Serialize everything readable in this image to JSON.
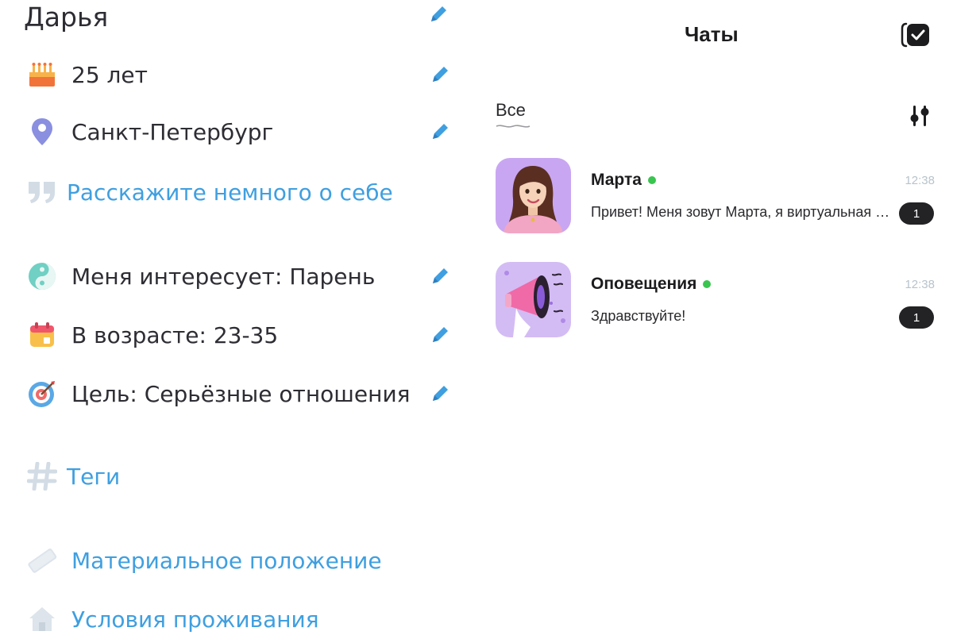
{
  "profile": {
    "name": "Дарья",
    "age": "25 лет",
    "city": "Санкт-Петербург",
    "about_prompt": "Расскажите немного о себе",
    "interest": "Меня интересует: Парень",
    "age_range": "В возрасте: 23-35",
    "goal": "Цель: Серьёзные отношения",
    "tags": "Теги",
    "finance": "Материальное положение",
    "living": "Условия проживания",
    "icons": {
      "age": "birthday-cake-icon",
      "city": "location-pin-icon",
      "about": "quote-icon",
      "interest": "yin-yang-icon",
      "age_range": "calendar-icon",
      "goal": "target-icon",
      "tags": "hashtag-icon",
      "finance": "money-icon",
      "living": "house-icon",
      "edit": "pencil-icon"
    },
    "link_color": "#3f9fe0",
    "muted_icon_color": "#cfd8e0"
  },
  "chats": {
    "title": "Чаты",
    "filter_tab": "Все",
    "icons": {
      "header": "check-square-icon",
      "filter": "sliders-icon"
    },
    "items": [
      {
        "name": "Марта",
        "online": true,
        "time": "12:38",
        "message": "Привет! Меня зовут Марта, я виртуальная помощница",
        "unread": "1",
        "avatar": "woman-portrait-avatar"
      },
      {
        "name": "Оповещения",
        "online": true,
        "time": "12:38",
        "message": "Здравствуйте!",
        "unread": "1",
        "avatar": "megaphone-avatar"
      }
    ],
    "online_color": "#39c54f",
    "badge_color": "#232326"
  }
}
